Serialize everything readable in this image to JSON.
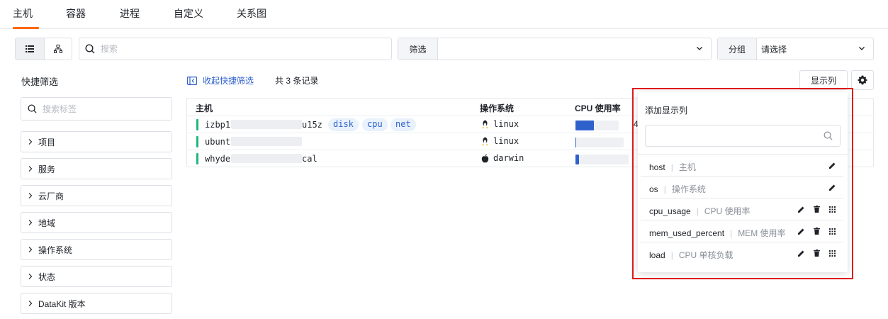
{
  "tabs": [
    {
      "label": "主机",
      "active": true
    },
    {
      "label": "容器",
      "active": false
    },
    {
      "label": "进程",
      "active": false
    },
    {
      "label": "自定义",
      "active": false
    },
    {
      "label": "关系图",
      "active": false
    }
  ],
  "toolbar": {
    "search_placeholder": "搜索",
    "filter_label": "筛选",
    "filter_value": "",
    "group_label": "分组",
    "group_value": "请选择"
  },
  "quick_filter": {
    "title": "快捷筛选",
    "search_placeholder": "搜索标签",
    "items": [
      "项目",
      "服务",
      "云厂商",
      "地域",
      "操作系统",
      "状态",
      "DataKit 版本"
    ]
  },
  "list": {
    "collapse_label": "收起快捷筛选",
    "record_count": "共 3 条记录",
    "display_columns_label": "显示列"
  },
  "table": {
    "columns": [
      "主机",
      "操作系统",
      "CPU 使用率"
    ],
    "rows": [
      {
        "host_prefix": "izbp1",
        "host_suffix": "u15z",
        "tags": [
          "disk",
          "cpu",
          "net"
        ],
        "os": "linux",
        "os_icon": "linux-tux-icon",
        "cpu_usage": 0.42,
        "trail": "4"
      },
      {
        "host_prefix": "ubunt",
        "host_suffix": "",
        "tags": [],
        "os": "linux",
        "os_icon": "linux-tux-icon",
        "cpu_usage": 0.02,
        "trail": ""
      },
      {
        "host_prefix": "whyde",
        "host_suffix": "cal",
        "tags": [],
        "os": "darwin",
        "os_icon": "apple-icon",
        "cpu_usage": 0.07,
        "trail": ""
      }
    ]
  },
  "popover": {
    "title": "添加显示列",
    "search_placeholder": "",
    "items": [
      {
        "key": "host",
        "label": "主机",
        "actions": [
          "edit"
        ]
      },
      {
        "key": "os",
        "label": "操作系统",
        "actions": [
          "edit"
        ]
      },
      {
        "key": "cpu_usage",
        "label": "CPU 使用率",
        "actions": [
          "edit",
          "delete",
          "drag"
        ]
      },
      {
        "key": "mem_used_percent",
        "label": "MEM 使用率",
        "actions": [
          "edit",
          "delete",
          "drag"
        ]
      },
      {
        "key": "load",
        "label": "CPU 单核负载",
        "actions": [
          "edit",
          "delete",
          "drag"
        ]
      }
    ]
  },
  "colors": {
    "accent": "#ff6a00",
    "link": "#2f61cc",
    "status_ok": "#1fb77b",
    "highlight_frame": "#e01b1b"
  }
}
